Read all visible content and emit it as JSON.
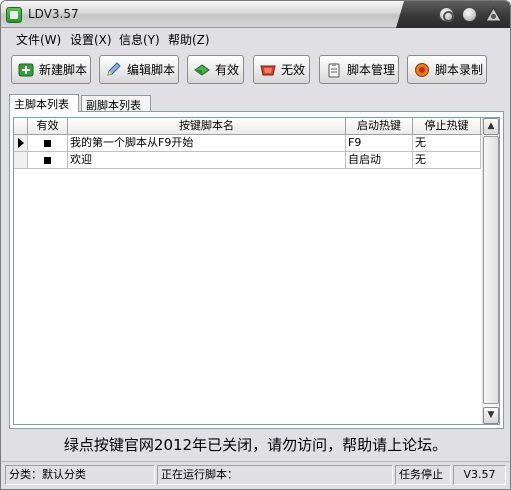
{
  "window": {
    "title": "LDV3.57"
  },
  "menu": [
    {
      "label": "文件(W)"
    },
    {
      "label": "设置(X)"
    },
    {
      "label": "信息(Y)"
    },
    {
      "label": "帮助(Z)"
    }
  ],
  "toolbar": {
    "new_script": "新建脚本",
    "edit_script": "编辑脚本",
    "enable": "有效",
    "disable": "无效",
    "manage_script": "脚本管理",
    "record_script": "脚本录制"
  },
  "tabs": [
    {
      "label": "主脚本列表",
      "active": true
    },
    {
      "label": "副脚本列表",
      "active": false
    }
  ],
  "table": {
    "columns": [
      "有效",
      "按键脚本名",
      "启动热键",
      "停止热键"
    ],
    "rows": [
      {
        "enabled": true,
        "name": "我的第一个脚本从F9开始",
        "start_hotkey": "F9",
        "stop_hotkey": "无"
      },
      {
        "enabled": true,
        "name": "欢迎",
        "start_hotkey": "自启动",
        "stop_hotkey": "无"
      }
    ]
  },
  "notice": "绿点按键官网2012年已关闭，请勿访问，帮助请上论坛。",
  "statusbar": {
    "category": "分类：默认分类",
    "running": "正在运行脚本：",
    "task_state": "任务停止",
    "version": "V3.57"
  },
  "colors": {
    "window_bg": "#e0dfe3",
    "title_dark": "#3c3c3c",
    "grid_border": "#7f9db9"
  }
}
